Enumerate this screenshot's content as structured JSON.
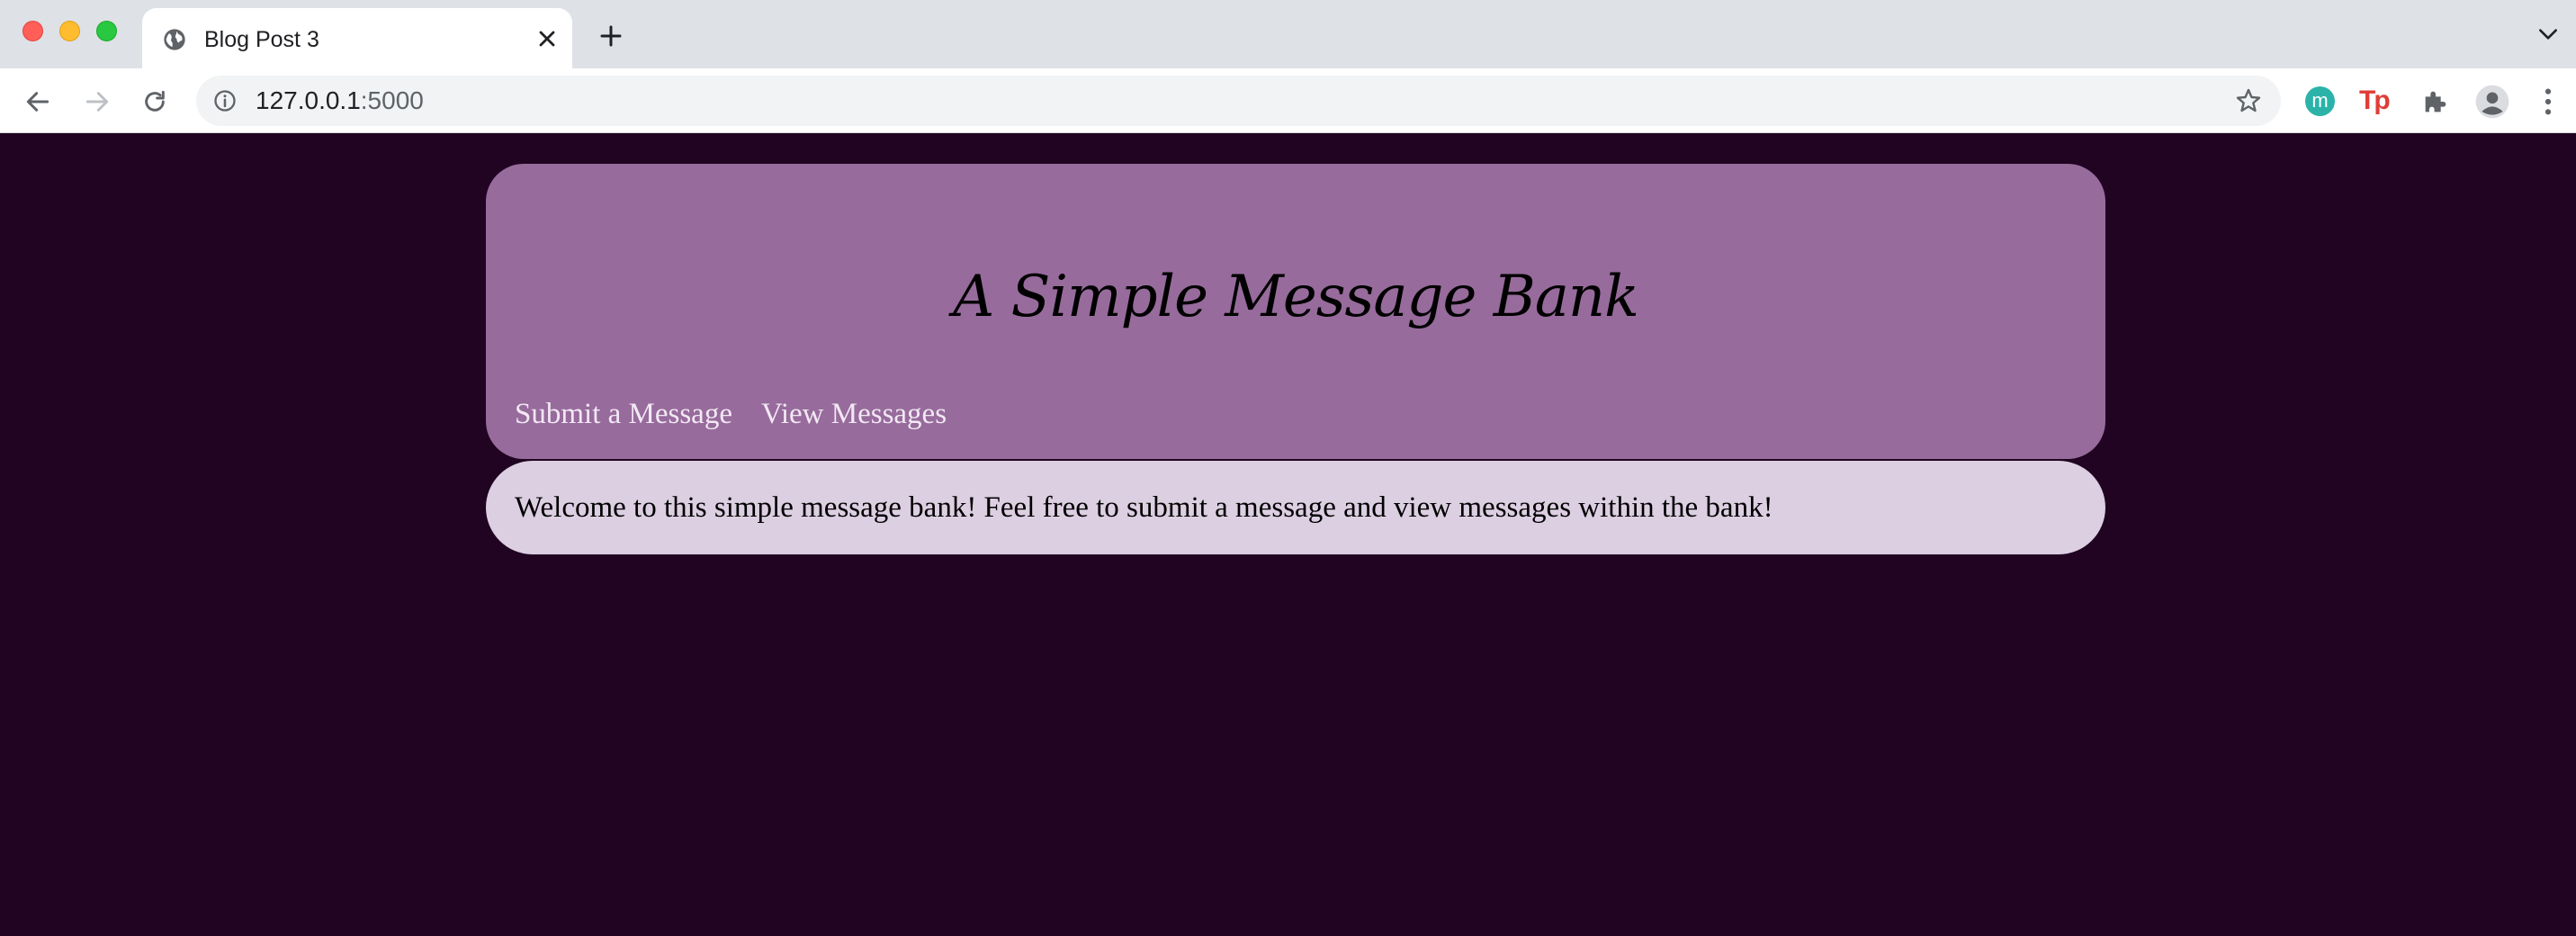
{
  "browser": {
    "tab": {
      "title": "Blog Post 3"
    },
    "address_bar": {
      "host": "127.0.0.1",
      "port": ":5000"
    },
    "extensions": {
      "m_label": "m",
      "tp_label": "Tp"
    },
    "icons": [
      "globe-icon",
      "close-icon",
      "plus-icon",
      "chevron-down-icon",
      "back-arrow-icon",
      "forward-arrow-icon",
      "reload-icon",
      "info-icon",
      "star-icon",
      "puzzle-icon",
      "avatar-icon",
      "kebab-menu-icon"
    ]
  },
  "page": {
    "title": "A Simple Message Bank",
    "nav": [
      {
        "label": "Submit a Message"
      },
      {
        "label": "View Messages"
      }
    ],
    "welcome": "Welcome to this simple message bank! Feel free to submit a message and view messages within the bank!"
  },
  "colors": {
    "background": "#200422",
    "header": "#976b9c",
    "welcome_panel": "#dccfe2",
    "nav_link": "#f2e8f4"
  }
}
